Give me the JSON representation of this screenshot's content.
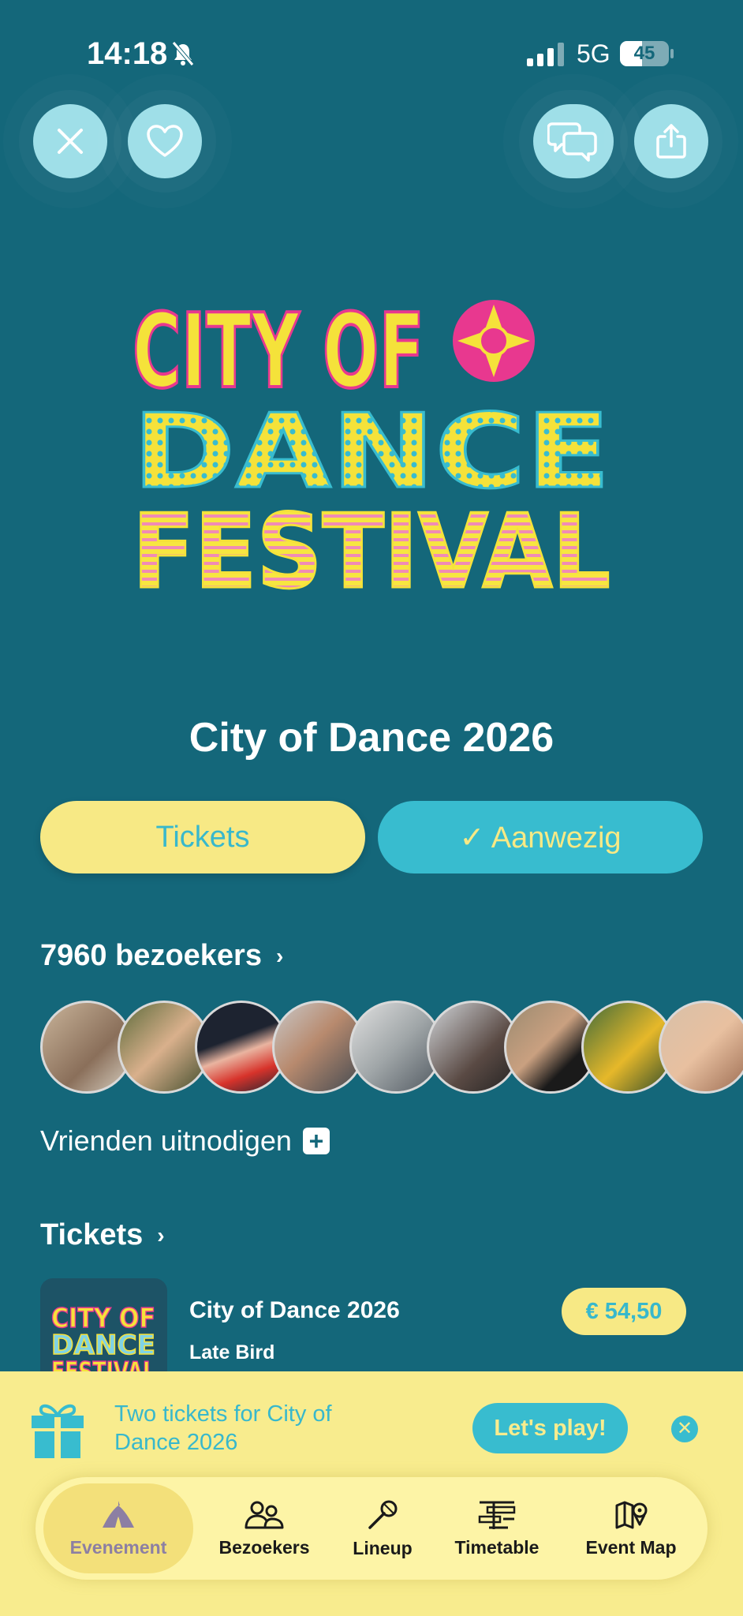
{
  "status_bar": {
    "time": "14:18",
    "network": "5G",
    "battery": "45",
    "battery_level": 0.45
  },
  "header": {
    "close_icon": "close-icon",
    "favorite_icon": "heart-icon",
    "chat_icon": "chat-bubbles-icon",
    "share_icon": "share-icon"
  },
  "logo": {
    "line1": "CITY OF",
    "line2": "DANCE",
    "line3": "FESTIVAL"
  },
  "event": {
    "title": "City of Dance 2026"
  },
  "actions": {
    "tickets_label": "Tickets",
    "attending_label": "✓ Aanwezig"
  },
  "visitors": {
    "heading": "7960 bezoekers",
    "invite_label": "Vrienden uitnodigen"
  },
  "tickets": {
    "heading": "Tickets",
    "items": [
      {
        "name": "City of Dance 2026",
        "type": "Late Bird",
        "price": "€ 54,50"
      }
    ]
  },
  "promo": {
    "text": "Two tickets for City of Dance 2026",
    "button_label": "Let's play!"
  },
  "tabbar": {
    "tabs": [
      {
        "label": "Evenement",
        "icon": "tent-icon",
        "active": true
      },
      {
        "label": "Bezoekers",
        "icon": "people-icon",
        "active": false
      },
      {
        "label": "Lineup",
        "icon": "microphone-icon",
        "active": false
      },
      {
        "label": "Timetable",
        "icon": "timetable-icon",
        "active": false
      },
      {
        "label": "Event Map",
        "icon": "map-icon",
        "active": false
      }
    ]
  },
  "colors": {
    "background": "#14677a",
    "yellow": "#f7e985",
    "cyan": "#38bccf",
    "pink": "#e8388f"
  }
}
